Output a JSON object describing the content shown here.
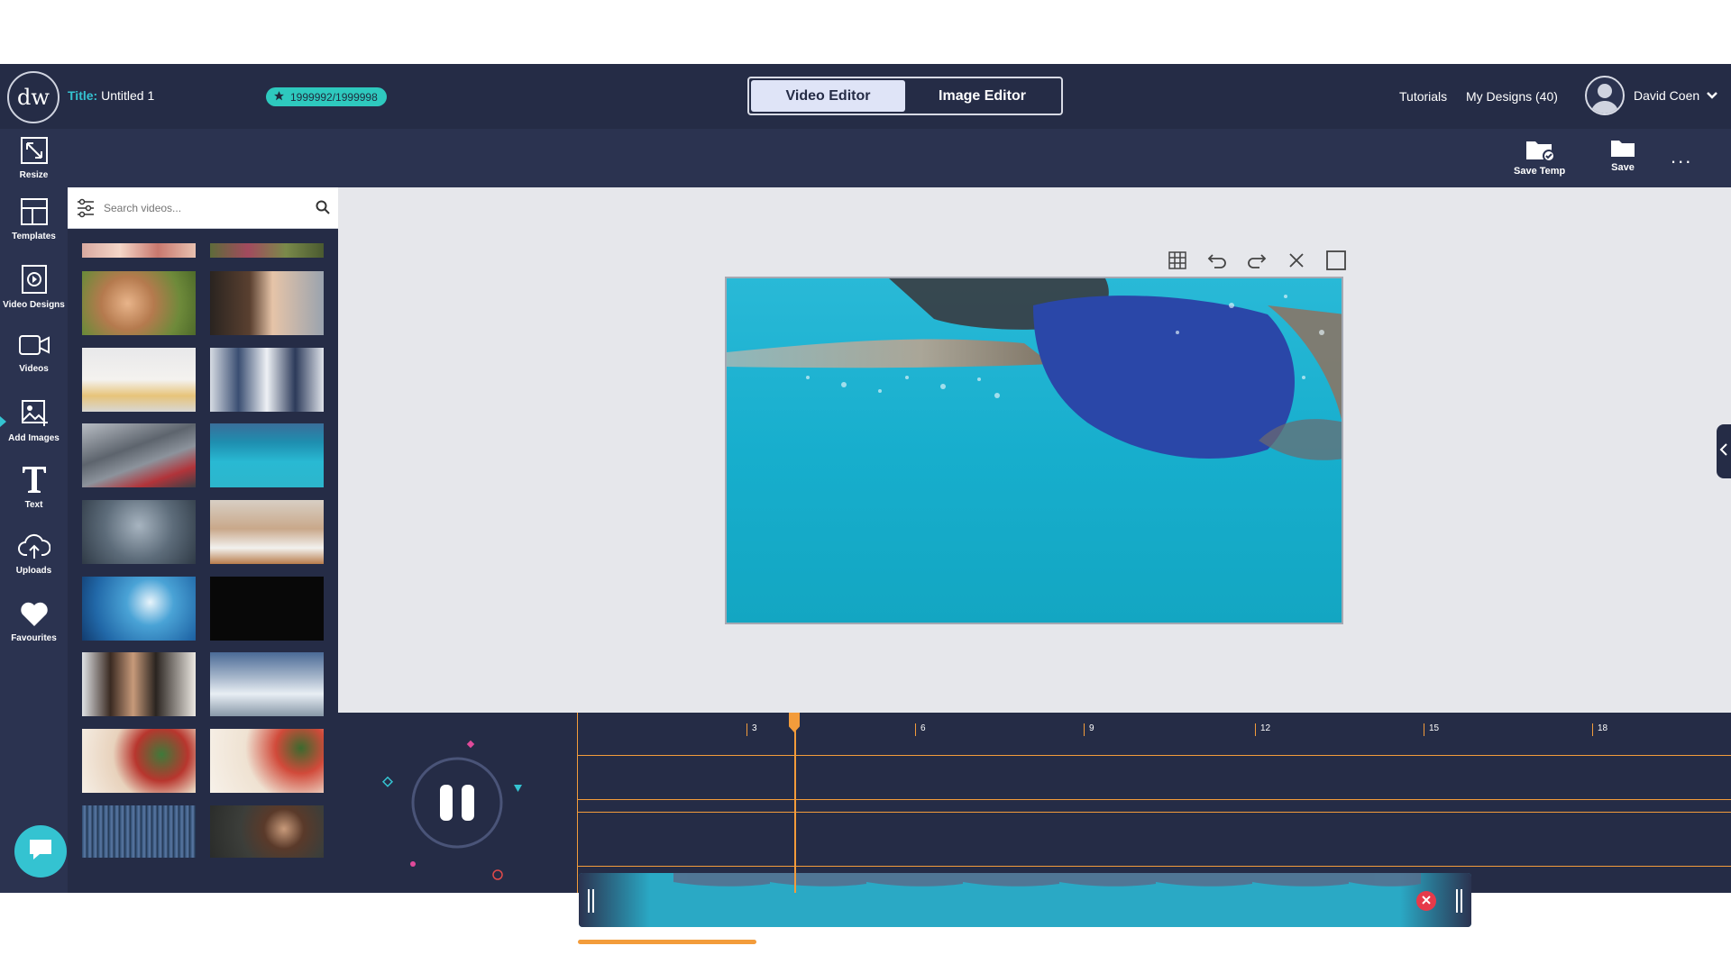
{
  "header": {
    "logo_text": "dw",
    "title_label": "Title:",
    "title_value": "Untitled 1",
    "credits": "1999992/1999998",
    "editor_tabs": [
      "Video Editor",
      "Image Editor"
    ],
    "links": [
      "Tutorials",
      "My Designs (40)"
    ],
    "user_name": "David Coen"
  },
  "toolbar": {
    "save_temp": "Save Temp",
    "save": "Save",
    "more": "..."
  },
  "sidebar": {
    "items": [
      "Resize",
      "Templates",
      "Video Designs",
      "Videos",
      "Add Images",
      "Text",
      "Uploads",
      "Favourites"
    ]
  },
  "search": {
    "placeholder": "Search videos..."
  },
  "timeline": {
    "ticks": [
      "3",
      "6",
      "9",
      "12",
      "15",
      "18"
    ],
    "progress_fraction": 0.155
  },
  "colors": {
    "accent": "#34c3d1",
    "brand_dark": "#252c46",
    "orange": "#f39c3b"
  }
}
